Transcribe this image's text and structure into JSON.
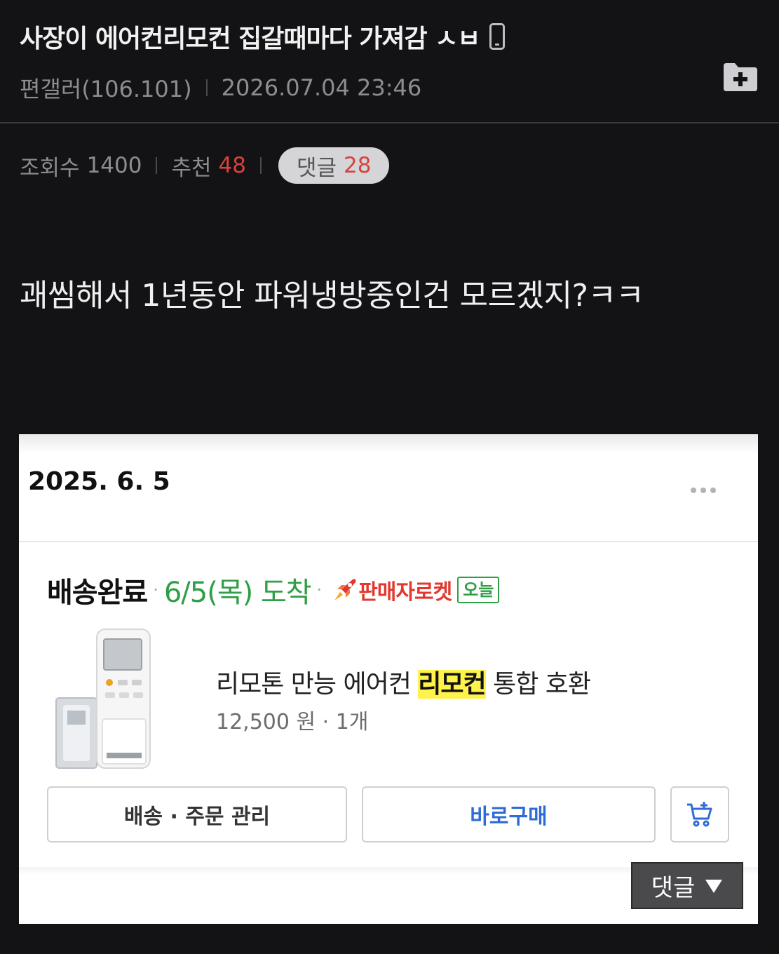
{
  "post": {
    "title": "사장이 에어컨리모컨 집갈때마다 가져감 ㅅㅂ",
    "author": "편갤러(106.101)",
    "datetime": "2026.07.04 23:46",
    "body": "괘씸해서 1년동안 파워냉방중인건 모르겠지?ㅋㅋ"
  },
  "stats": {
    "views_label": "조회수",
    "views": "1400",
    "recommend_label": "추천",
    "recommend": "48",
    "comments_label": "댓글",
    "comments": "28"
  },
  "order_card": {
    "date": "2025. 6. 5",
    "status": "배송완료",
    "arrival": "6/5(목) 도착",
    "rocket_label": "판매자로켓",
    "today_badge": "오늘",
    "product_name_before": "리모톤 만능 에어컨 ",
    "product_name_highlight": "리모컨",
    "product_name_after": " 통합 호환",
    "price": "12,500 원",
    "quantity": "1개",
    "btn_manage": "배송 · 주문 관리",
    "btn_buy": "바로구매"
  },
  "floating": {
    "comment_label": "댓글"
  },
  "colors": {
    "background": "#131215",
    "recommend_red": "#d8413f",
    "arrival_green": "#2f9e44",
    "rocket_red": "#e2382f",
    "buy_blue": "#2f6bd6",
    "highlight_yellow": "#fff24a"
  },
  "icons": {
    "device": "mobile-phone-icon",
    "folder": "folder-add-icon",
    "more": "more-dots-icon",
    "rocket": "rocket-icon",
    "cart": "cart-add-icon",
    "caret": "caret-down-icon"
  }
}
